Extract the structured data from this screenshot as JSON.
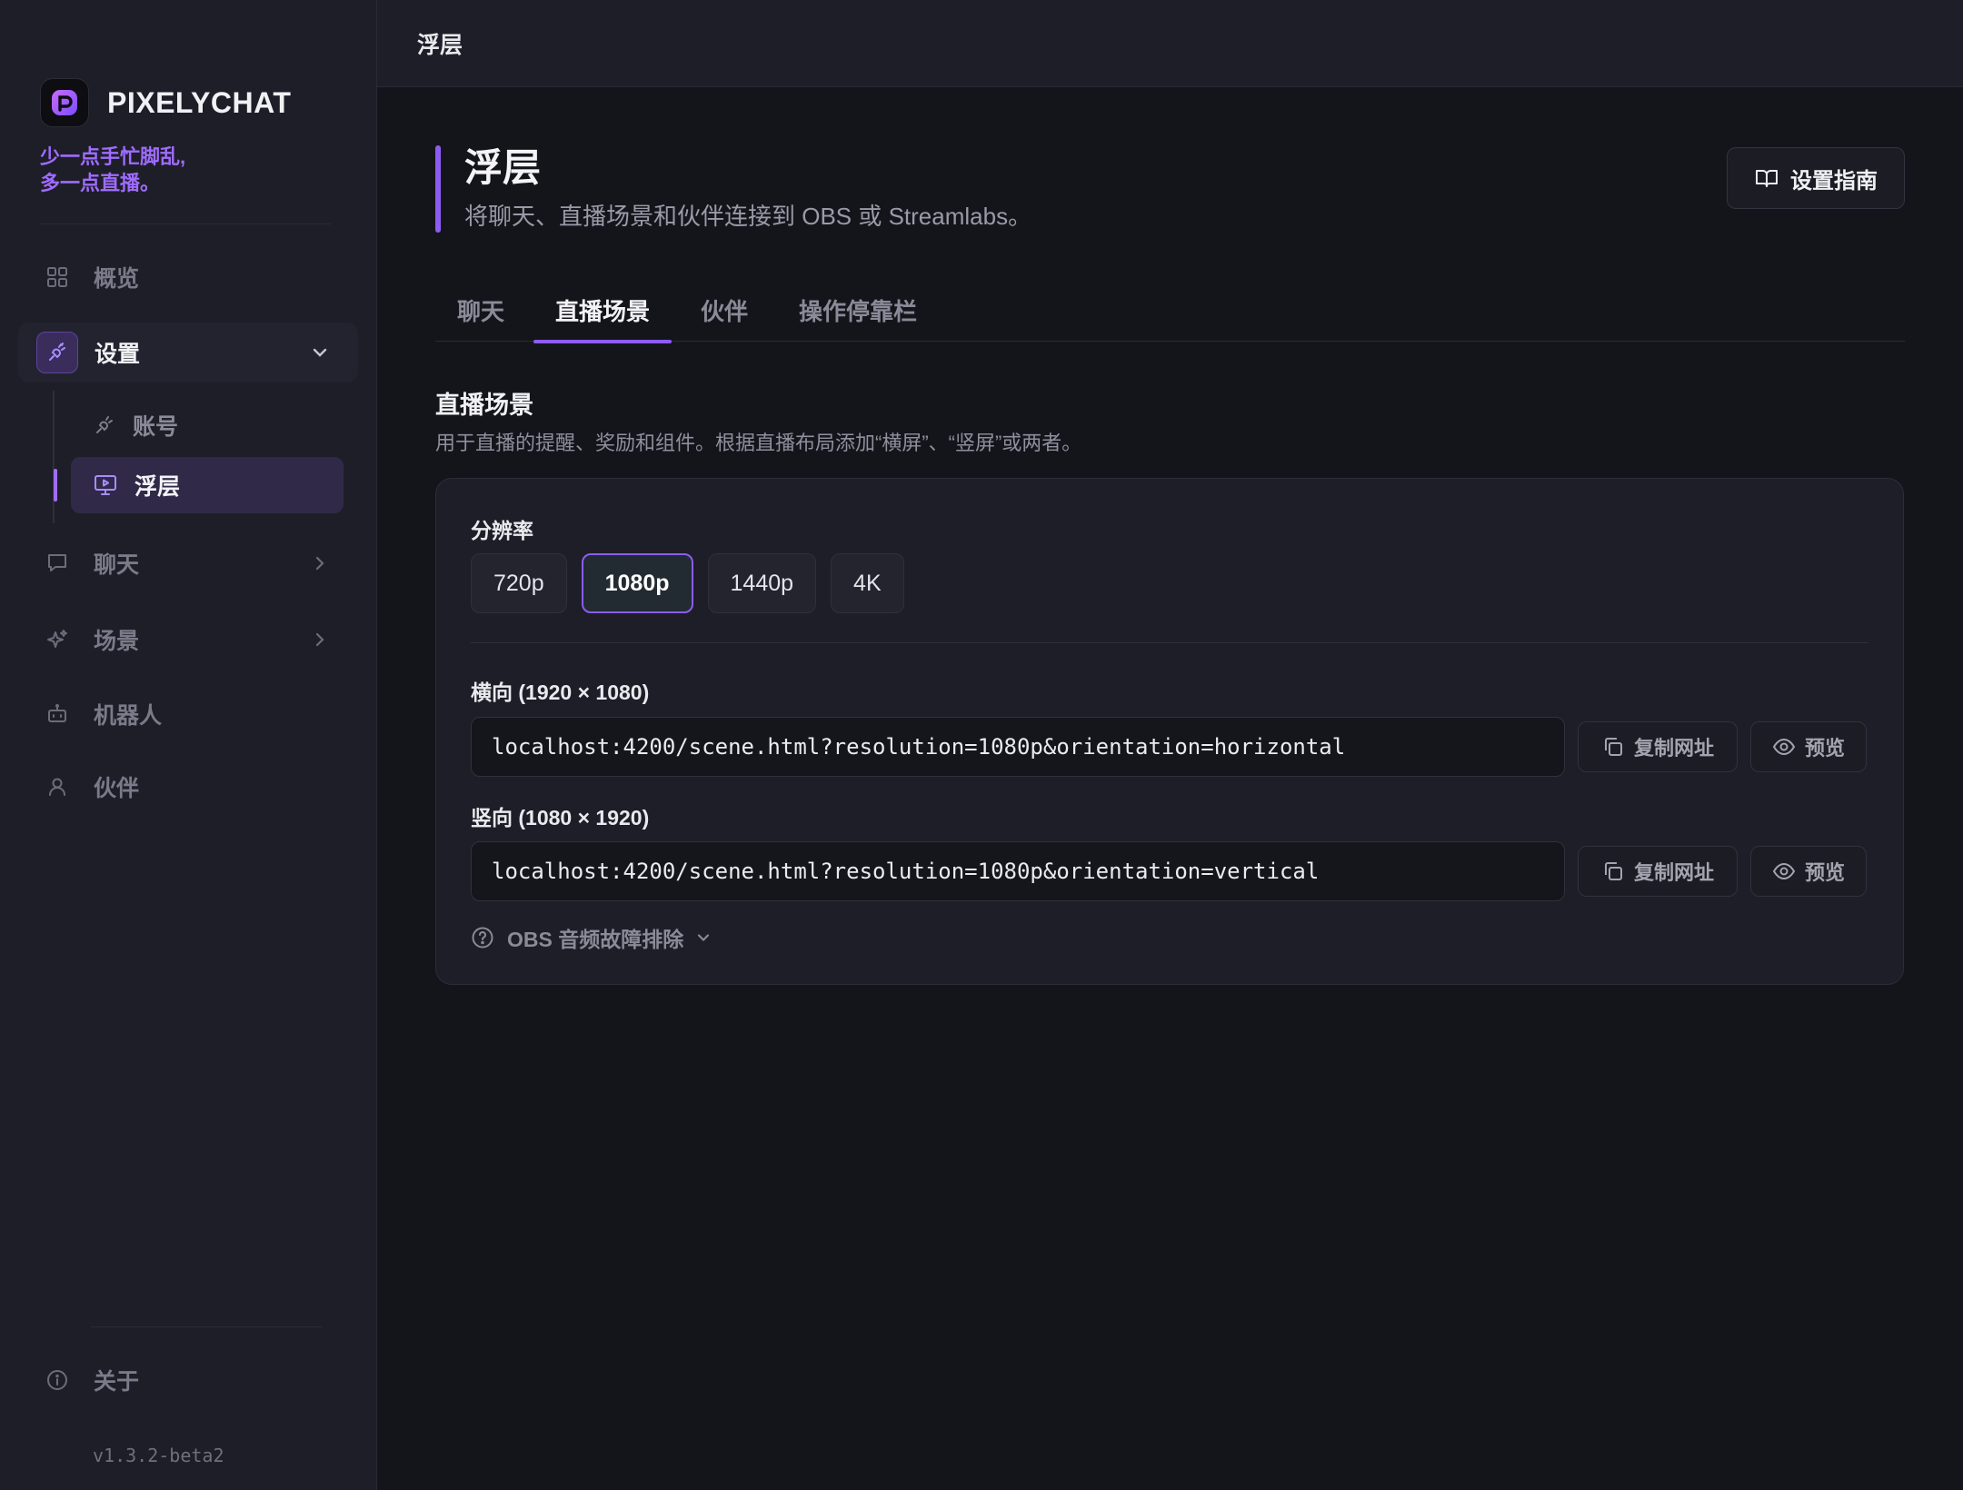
{
  "app": {
    "name": "PIXELYCHAT",
    "tagline_line1": "少一点手忙脚乱,",
    "tagline_line2": "多一点直播。",
    "version": "v1.3.2-beta2",
    "accent_color": "#8c5cf0"
  },
  "sidebar": {
    "overview": "概览",
    "settings": "设置",
    "settings_sub": {
      "account": "账号",
      "overlay": "浮层"
    },
    "chat": "聊天",
    "scenes": "场景",
    "bots": "机器人",
    "partners": "伙伴",
    "about": "关于"
  },
  "topbar": {
    "title": "浮层"
  },
  "page": {
    "title": "浮层",
    "subtitle": "将聊天、直播场景和伙伴连接到 OBS 或 Streamlabs。",
    "guide_button": "设置指南"
  },
  "tabs": [
    "聊天",
    "直播场景",
    "伙伴",
    "操作停靠栏"
  ],
  "active_tab": "直播场景",
  "section": {
    "title": "直播场景",
    "description": "用于直播的提醒、奖励和组件。根据直播布局添加“横屏”、“竖屏”或两者。"
  },
  "card": {
    "resolution_label": "分辨率",
    "resolutions": [
      "720p",
      "1080p",
      "1440p",
      "4K"
    ],
    "selected_resolution": "1080p",
    "horizontal_label": "横向 (1920 × 1080)",
    "horizontal_url": "localhost:4200/scene.html?resolution=1080p&orientation=horizontal",
    "vertical_label": "竖向 (1080 × 1920)",
    "vertical_url": "localhost:4200/scene.html?resolution=1080p&orientation=vertical",
    "copy_button": "复制网址",
    "preview_button": "预览",
    "troubleshoot": "OBS 音频故障排除"
  }
}
